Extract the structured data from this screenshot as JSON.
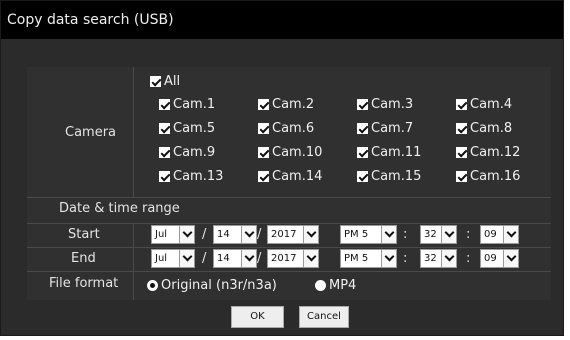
{
  "dialog": {
    "title": "Copy data search (USB)"
  },
  "camera": {
    "label": "Camera",
    "all_label": "All",
    "all_checked": true,
    "items": [
      {
        "label": "Cam.1",
        "checked": true
      },
      {
        "label": "Cam.2",
        "checked": true
      },
      {
        "label": "Cam.3",
        "checked": true
      },
      {
        "label": "Cam.4",
        "checked": true
      },
      {
        "label": "Cam.5",
        "checked": true
      },
      {
        "label": "Cam.6",
        "checked": true
      },
      {
        "label": "Cam.7",
        "checked": true
      },
      {
        "label": "Cam.8",
        "checked": true
      },
      {
        "label": "Cam.9",
        "checked": true
      },
      {
        "label": "Cam.10",
        "checked": true
      },
      {
        "label": "Cam.11",
        "checked": true
      },
      {
        "label": "Cam.12",
        "checked": true
      },
      {
        "label": "Cam.13",
        "checked": true
      },
      {
        "label": "Cam.14",
        "checked": true
      },
      {
        "label": "Cam.15",
        "checked": true
      },
      {
        "label": "Cam.16",
        "checked": true
      }
    ]
  },
  "range": {
    "title": "Date & time range",
    "start": {
      "label": "Start",
      "month": "Jul",
      "day": "14",
      "year": "2017",
      "hour": "PM 5",
      "minute": "32",
      "second": "09"
    },
    "end": {
      "label": "End",
      "month": "Jul",
      "day": "14",
      "year": "2017",
      "hour": "PM 5",
      "minute": "32",
      "second": "09"
    },
    "date_separator": "/",
    "time_separator": ":"
  },
  "file_format": {
    "label": "File format",
    "options": [
      {
        "label": "Original (n3r/n3a)",
        "selected": true
      },
      {
        "label": "MP4",
        "selected": false
      }
    ]
  },
  "buttons": {
    "ok": "OK",
    "cancel": "Cancel"
  }
}
